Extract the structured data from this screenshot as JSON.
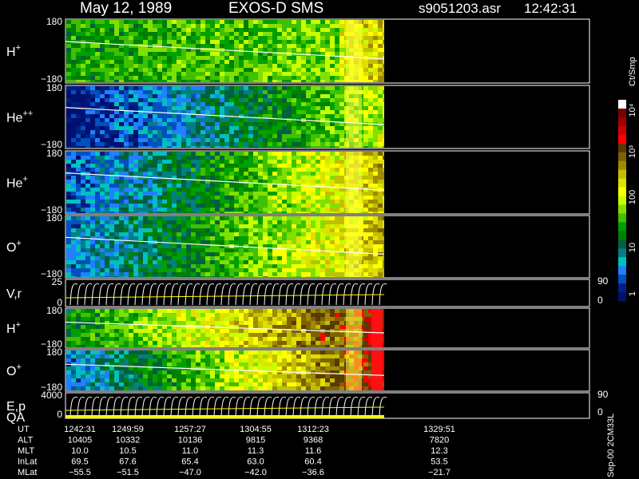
{
  "header": {
    "date": "May 12, 1989",
    "instrument": "EXOS-D SMS",
    "file": "s9051203.asr",
    "time": "12:42:31"
  },
  "panels": [
    {
      "label": "H",
      "sup": "+",
      "top_tick": "180",
      "bottom_tick": "−180",
      "trace": "gradient_h"
    },
    {
      "label": "He",
      "sup": "++",
      "top_tick": "180",
      "bottom_tick": "−180",
      "trace": "gradient_heplusplus"
    },
    {
      "label": "He",
      "sup": "+",
      "top_tick": "180",
      "bottom_tick": "−180",
      "trace": "gradient_heplus"
    },
    {
      "label": "O",
      "sup": "+",
      "top_tick": "180",
      "bottom_tick": "−180",
      "trace": "gradient_o"
    },
    {
      "label": "V,r",
      "sup": "",
      "top_tick": "25",
      "bottom_tick": "0",
      "right_top": "90",
      "right_bottom": "0",
      "trace": "lines"
    },
    {
      "label": "H",
      "sup": "+",
      "top_tick": "180",
      "bottom_tick": "−180",
      "trace": "gradient_h2"
    },
    {
      "label": "O",
      "sup": "+",
      "top_tick": "180",
      "bottom_tick": "−180",
      "trace": "gradient_o2"
    },
    {
      "label": "E,p",
      "sup": "",
      "label2": "QA",
      "top_tick": "4000",
      "bottom_tick": "0",
      "right_top": "90",
      "right_bottom": "0",
      "trace": "lines"
    }
  ],
  "colorbar": {
    "unit": "Ct/Smp",
    "labels": [
      "10⁴",
      "10³",
      "100",
      "10",
      "1"
    ],
    "colors": [
      "#ffffff",
      "#7a0000",
      "#a00000",
      "#d00000",
      "#ff0000",
      "#5a3a00",
      "#806000",
      "#a08a00",
      "#c0c000",
      "#e0e000",
      "#ffff00",
      "#c8ff00",
      "#80e000",
      "#40c000",
      "#00a000",
      "#008000",
      "#006040",
      "#008080",
      "#00c0c0",
      "#2080ff",
      "#0050c0",
      "#002080",
      "#001070"
    ]
  },
  "footer": {
    "rows": [
      {
        "name": "UT",
        "values": [
          "1242:31",
          "1249:59",
          "1257:27",
          "1304:55",
          "1312:23",
          "",
          "1329:51"
        ]
      },
      {
        "name": "ALT",
        "values": [
          "10405",
          "10332",
          "10136",
          "9815",
          "9368",
          "",
          "7820"
        ]
      },
      {
        "name": "MLT",
        "values": [
          "10.0",
          "10.5",
          "11.0",
          "11.3",
          "11.6",
          "",
          "12.3"
        ]
      },
      {
        "name": "InLat",
        "values": [
          "69.5",
          "67.6",
          "65.4",
          "63.0",
          "60.4",
          "",
          "53.5"
        ]
      },
      {
        "name": "MLat",
        "values": [
          "−55.5",
          "−51.5",
          "−47.0",
          "−42.0",
          "−36.6",
          "",
          "−21.7"
        ]
      }
    ],
    "side_note": "Sep-00 2CM33L"
  },
  "chart_data": {
    "type": "heatmap",
    "title": "May 12, 1989   EXOS-D SMS",
    "xlabel": "UT",
    "ylabel": "",
    "x_ticks": [
      "1242:31",
      "1249:59",
      "1257:27",
      "1304:55",
      "1312:23",
      "1329:51"
    ],
    "y_range_angle": [
      -180,
      180
    ],
    "series": [
      {
        "name": "H+"
      },
      {
        "name": "He++"
      },
      {
        "name": "He+"
      },
      {
        "name": "O+"
      },
      {
        "name": "V,r"
      },
      {
        "name": "H+"
      },
      {
        "name": "O+"
      },
      {
        "name": "E,p"
      }
    ],
    "colorbar_range": [
      1,
      10000
    ],
    "colorbar_scale": "log",
    "colorbar_unit": "Ct/Smp"
  }
}
